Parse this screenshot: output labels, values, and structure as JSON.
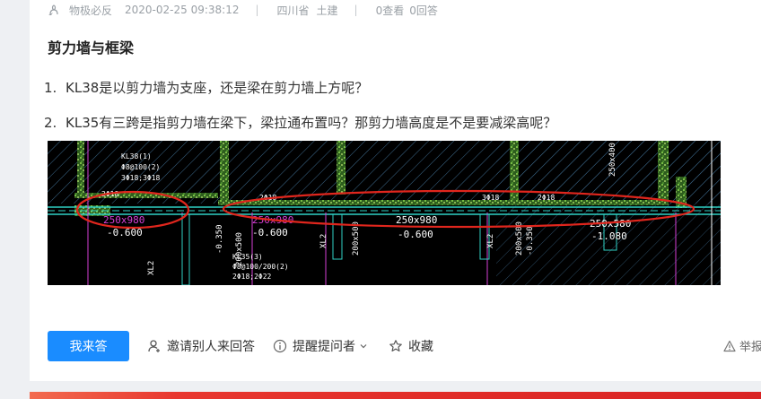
{
  "post": {
    "author": "物极必反",
    "datetime": "2020-02-25 09:38:12",
    "separator": "|",
    "location": "四川省",
    "category": "土建",
    "views": "0查看",
    "answers": "0回答",
    "title": "剪力墙与框梁",
    "questions": [
      {
        "num": "1.",
        "text": "KL38是以剪力墙为支座，还是梁在剪力墙上方呢？"
      },
      {
        "num": "2.",
        "text": "KL35有三跨是指剪力墙在梁下，梁拉通布置吗？那剪力墙高度是不是要减梁高呢？"
      }
    ]
  },
  "drawing": {
    "labels": {
      "beam_size_1": "250x980",
      "beam_elev_1": "-0.600",
      "beam_size_2": "250x980",
      "beam_elev_2": "-0.600",
      "beam_size_3": "250x980",
      "beam_elev_3": "-0.600",
      "beam_size_4": "250x580",
      "beam_elev_4": "-1.080",
      "kl38": "KL38(1)",
      "kl38_stirrup": "Φ8@100(2)",
      "kl38_bars": "3Φ18;3Φ18",
      "kl35": "KL35(3)",
      "kl35_stirrup": "Φ8@100/200(2)",
      "kl35_bars": "2Φ18;2Φ22",
      "top_bar_1": "2Φ18",
      "top_bar_2": "3Φ18",
      "top_bar_3": "2Φ18",
      "top_bar_4": "2Φ18",
      "sec_1": "200x500",
      "sec_2": "200x500",
      "sec_3": "200x500",
      "elev_1": "-0.350",
      "elev_2": "-0.350",
      "xl_1": "XL2",
      "xl_2": "XL2",
      "xl_3": "XL2",
      "vert_text": "250x400"
    },
    "colors": {
      "background": "#000000",
      "hatch": "#3d6b8e",
      "wall_fill": "#6bbf3f",
      "beam_line": "#2fd1c5",
      "magenta": "#d63fd6",
      "red_ellipse": "#e0261d",
      "white_text": "#ffffff",
      "yellow_text": "#e8d54a"
    }
  },
  "actions": {
    "answer_button": "我来答",
    "invite": "邀请别人来回答",
    "remind": "提醒提问者",
    "favorite": "收藏",
    "report": "举报"
  }
}
